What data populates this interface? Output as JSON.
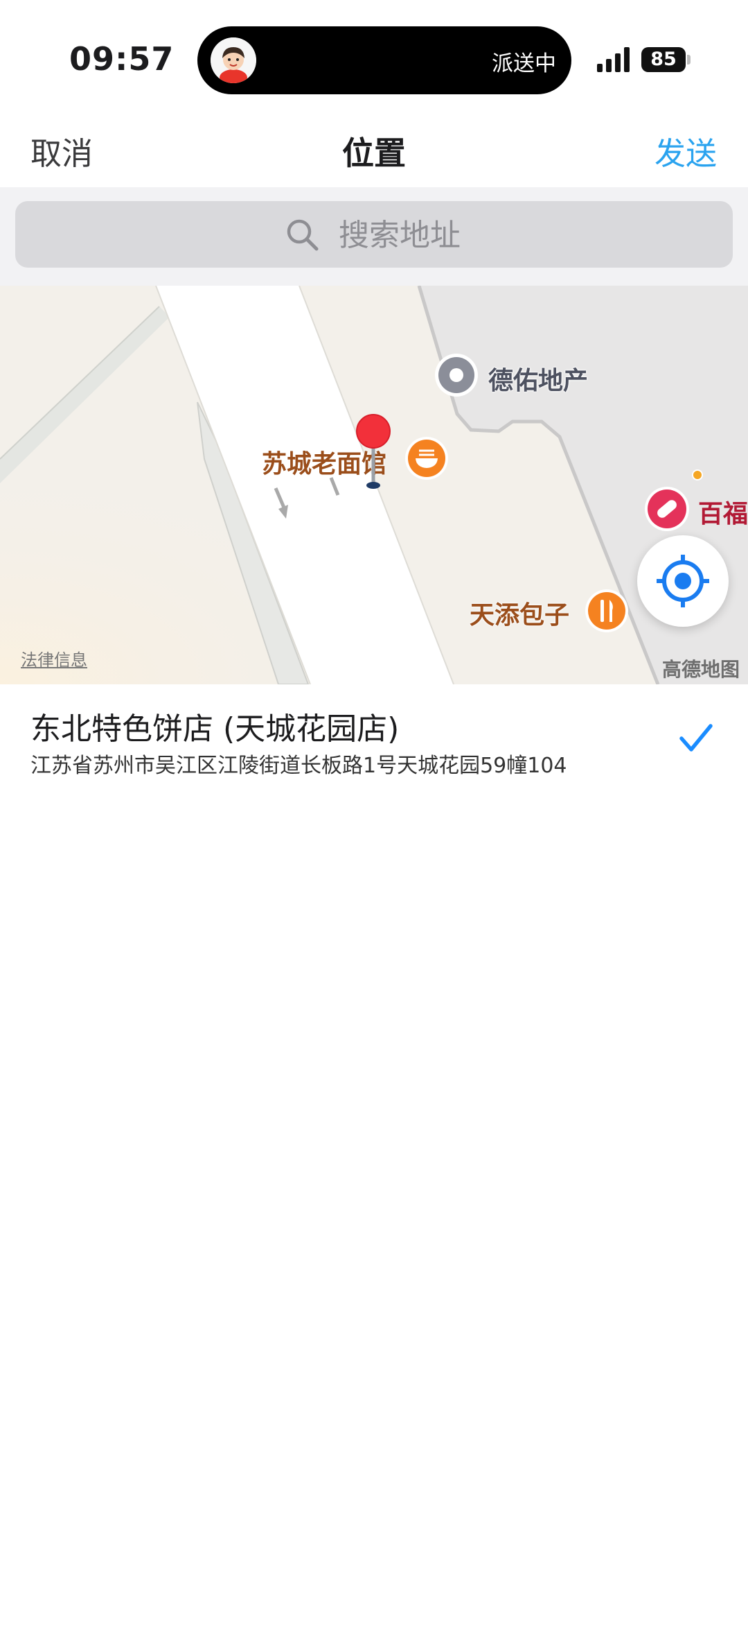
{
  "status_bar": {
    "time": "09:57",
    "activity_status": "派送中",
    "battery_level": "85"
  },
  "nav": {
    "cancel_label": "取消",
    "title": "位置",
    "send_label": "发送"
  },
  "search": {
    "placeholder": "搜索地址"
  },
  "map": {
    "pois": [
      {
        "label": "德佑地产",
        "icon": "location-dot-icon"
      },
      {
        "label": "苏城老面馆",
        "icon": "noodle-bowl-icon"
      },
      {
        "label": "百福",
        "icon": "pharmacy-pill-icon"
      },
      {
        "label": "天添包子",
        "icon": "fork-knife-icon"
      }
    ],
    "legal_link": "法律信息",
    "provider_logo": "高德地图"
  },
  "result": {
    "title": "东北特色饼店 (天城花园店)",
    "address": "江苏省苏州市吴江区江陵街道长板路1号天城花园59幢104",
    "selected": true
  },
  "colors": {
    "accent_blue": "#2aa3ef",
    "check_blue": "#1a8cff",
    "pin_red": "#f2303a",
    "poi_orange": "#f58220"
  }
}
